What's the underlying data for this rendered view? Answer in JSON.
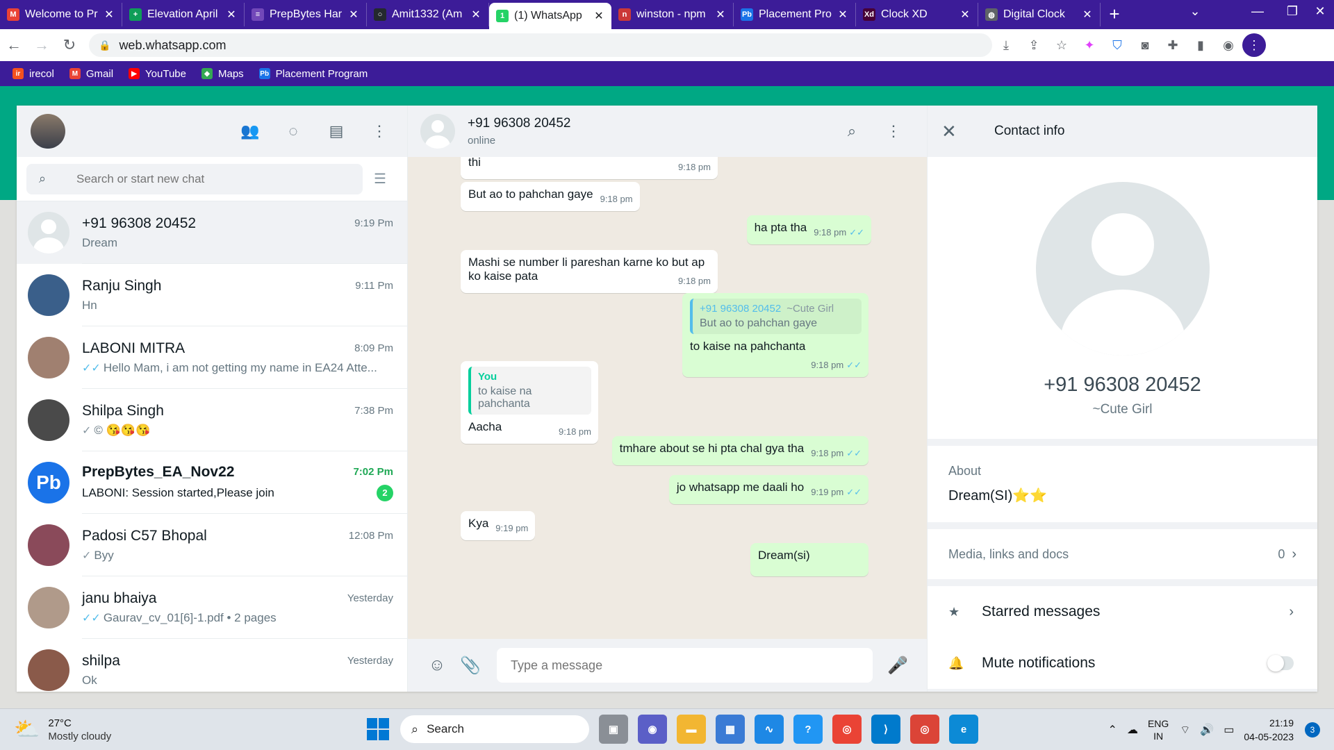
{
  "browser": {
    "tabs": [
      {
        "title": "Welcome to Pr",
        "favicon": "gmail-icon",
        "color": "#ea4335",
        "letter": "M",
        "active": false
      },
      {
        "title": "Elevation April",
        "favicon": "sheets-icon",
        "color": "#0f9d58",
        "letter": "+",
        "active": false
      },
      {
        "title": "PrepBytes Har",
        "favicon": "forms-icon",
        "color": "#7248b9",
        "letter": "≡",
        "active": false
      },
      {
        "title": "Amit1332 (Am",
        "favicon": "github-icon",
        "color": "#24292e",
        "letter": "○",
        "active": false
      },
      {
        "title": "(1) WhatsApp",
        "favicon": "whatsapp-icon",
        "color": "#25d366",
        "letter": "1",
        "active": true
      },
      {
        "title": "winston - npm",
        "favicon": "npm-icon",
        "color": "#cb3837",
        "letter": "n",
        "active": false
      },
      {
        "title": "Placement Pro",
        "favicon": "prepbytes-icon",
        "color": "#1a73e8",
        "letter": "Pb",
        "active": false
      },
      {
        "title": "Clock XD",
        "favicon": "xd-icon",
        "color": "#470137",
        "letter": "Xd",
        "active": false
      },
      {
        "title": "Digital Clock",
        "favicon": "globe-icon",
        "color": "#5f6368",
        "letter": "◍",
        "active": false
      }
    ],
    "url": "web.whatsapp.com",
    "bookmarks": [
      {
        "label": "irecol",
        "color": "#f4511e",
        "letter": "ir"
      },
      {
        "label": "Gmail",
        "color": "#ea4335",
        "letter": "M"
      },
      {
        "label": "YouTube",
        "color": "#ff0000",
        "letter": "▶"
      },
      {
        "label": "Maps",
        "color": "#34a853",
        "letter": "◆"
      },
      {
        "label": "Placement Program",
        "color": "#1a73e8",
        "letter": "Pb"
      }
    ]
  },
  "sidebar": {
    "search_placeholder": "Search or start new chat",
    "chats": [
      {
        "name": "+91 96308 20452",
        "time": "9:19 Pm",
        "preview": "Dream",
        "tick": "",
        "selected": true,
        "default_avatar": true,
        "avatar_color": "#dfe5e7",
        "unread": "",
        "bold": false
      },
      {
        "name": "Ranju Singh",
        "time": "9:11 Pm",
        "preview": "Hn",
        "tick": "",
        "selected": false,
        "default_avatar": false,
        "avatar_color": "#3a5f8a",
        "unread": "",
        "bold": false
      },
      {
        "name": "LABONI MITRA",
        "time": "8:09 Pm",
        "preview": "Hello Mam, i am not getting my name in EA24 Atte...",
        "tick": "✓✓",
        "selected": false,
        "default_avatar": false,
        "avatar_color": "#a08070",
        "unread": "",
        "bold": false
      },
      {
        "name": "Shilpa Singh",
        "time": "7:38 Pm",
        "preview": "© 😘😘😘",
        "tick": "✓",
        "selected": false,
        "default_avatar": false,
        "avatar_color": "#4a4a4a",
        "unread": "",
        "bold": false
      },
      {
        "name": "PrepBytes_EA_Nov22",
        "time": "7:02 Pm",
        "preview": "LABONI: Session started,Please join",
        "tick": "",
        "selected": false,
        "default_avatar": false,
        "avatar_color": "#1a73e8",
        "avatar_text": "Pb",
        "unread": "2",
        "bold": true
      },
      {
        "name": "Padosi C57 Bhopal",
        "time": "12:08 Pm",
        "preview": "Byy",
        "tick": "✓",
        "selected": false,
        "default_avatar": false,
        "avatar_color": "#8a4a5a",
        "unread": "",
        "bold": false
      },
      {
        "name": "janu bhaiya",
        "time": "Yesterday",
        "preview": "Gaurav_cv_01[6]-1.pdf • 2 pages",
        "tick": "✓✓",
        "selected": false,
        "default_avatar": false,
        "avatar_color": "#b09a8a",
        "unread": "",
        "bold": false
      },
      {
        "name": "shilpa",
        "time": "Yesterday",
        "preview": "Ok",
        "tick": "",
        "selected": false,
        "default_avatar": false,
        "avatar_color": "#8a5a4a",
        "unread": "",
        "bold": false
      }
    ]
  },
  "conversation": {
    "contact_name": "+91 96308 20452",
    "status": "online",
    "compose_placeholder": "Type a message",
    "messages": [
      {
        "dir": "in",
        "text": "thi",
        "time": "9:18 pm"
      },
      {
        "dir": "in",
        "text": "But ao to pahchan gaye",
        "time": "9:18 pm"
      },
      {
        "dir": "out",
        "text": "ha pta tha",
        "time": "9:18 pm"
      },
      {
        "dir": "in",
        "text": "Mashi se number li pareshan karne ko but ap ko kaise pata",
        "time": "9:18 pm"
      },
      {
        "dir": "out",
        "quote_name": "+91 96308 20452",
        "quote_push": "~Cute Girl",
        "quote_text": "But ao to pahchan gaye",
        "text": "to kaise na pahchanta",
        "time": "9:18 pm"
      },
      {
        "dir": "in",
        "quote_name": "You",
        "quote_text": "to kaise na pahchanta",
        "text": "Aacha",
        "time": "9:18 pm"
      },
      {
        "dir": "out",
        "text": "tmhare about se hi pta chal gya tha",
        "time": "9:18 pm"
      },
      {
        "dir": "out",
        "text": "jo whatsapp me daali ho",
        "time": "9:19 pm"
      },
      {
        "dir": "in",
        "text": "Kya",
        "time": "9:19 pm"
      },
      {
        "dir": "out",
        "text": "Dream(si)",
        "time": ""
      }
    ]
  },
  "contact_info": {
    "title": "Contact info",
    "number": "+91 96308 20452",
    "push_name": "~Cute Girl",
    "about_label": "About",
    "about_value": "Dream(SI)⭐⭐",
    "media_label": "Media, links and docs",
    "media_count": "0",
    "starred_label": "Starred messages",
    "mute_label": "Mute notifications"
  },
  "taskbar": {
    "temp": "27°C",
    "weather": "Mostly cloudy",
    "search_label": "Search",
    "lang1": "ENG",
    "lang2": "IN",
    "time": "21:19",
    "date": "04-05-2023",
    "notifications": "3"
  }
}
